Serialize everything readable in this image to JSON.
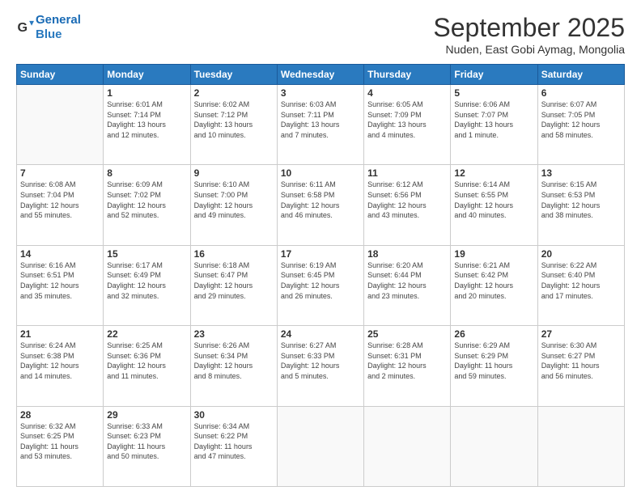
{
  "logo": {
    "line1": "General",
    "line2": "Blue"
  },
  "header": {
    "title": "September 2025",
    "subtitle": "Nuden, East Gobi Aymag, Mongolia"
  },
  "weekdays": [
    "Sunday",
    "Monday",
    "Tuesday",
    "Wednesday",
    "Thursday",
    "Friday",
    "Saturday"
  ],
  "weeks": [
    [
      {
        "day": "",
        "info": ""
      },
      {
        "day": "1",
        "info": "Sunrise: 6:01 AM\nSunset: 7:14 PM\nDaylight: 13 hours\nand 12 minutes."
      },
      {
        "day": "2",
        "info": "Sunrise: 6:02 AM\nSunset: 7:12 PM\nDaylight: 13 hours\nand 10 minutes."
      },
      {
        "day": "3",
        "info": "Sunrise: 6:03 AM\nSunset: 7:11 PM\nDaylight: 13 hours\nand 7 minutes."
      },
      {
        "day": "4",
        "info": "Sunrise: 6:05 AM\nSunset: 7:09 PM\nDaylight: 13 hours\nand 4 minutes."
      },
      {
        "day": "5",
        "info": "Sunrise: 6:06 AM\nSunset: 7:07 PM\nDaylight: 13 hours\nand 1 minute."
      },
      {
        "day": "6",
        "info": "Sunrise: 6:07 AM\nSunset: 7:05 PM\nDaylight: 12 hours\nand 58 minutes."
      }
    ],
    [
      {
        "day": "7",
        "info": "Sunrise: 6:08 AM\nSunset: 7:04 PM\nDaylight: 12 hours\nand 55 minutes."
      },
      {
        "day": "8",
        "info": "Sunrise: 6:09 AM\nSunset: 7:02 PM\nDaylight: 12 hours\nand 52 minutes."
      },
      {
        "day": "9",
        "info": "Sunrise: 6:10 AM\nSunset: 7:00 PM\nDaylight: 12 hours\nand 49 minutes."
      },
      {
        "day": "10",
        "info": "Sunrise: 6:11 AM\nSunset: 6:58 PM\nDaylight: 12 hours\nand 46 minutes."
      },
      {
        "day": "11",
        "info": "Sunrise: 6:12 AM\nSunset: 6:56 PM\nDaylight: 12 hours\nand 43 minutes."
      },
      {
        "day": "12",
        "info": "Sunrise: 6:14 AM\nSunset: 6:55 PM\nDaylight: 12 hours\nand 40 minutes."
      },
      {
        "day": "13",
        "info": "Sunrise: 6:15 AM\nSunset: 6:53 PM\nDaylight: 12 hours\nand 38 minutes."
      }
    ],
    [
      {
        "day": "14",
        "info": "Sunrise: 6:16 AM\nSunset: 6:51 PM\nDaylight: 12 hours\nand 35 minutes."
      },
      {
        "day": "15",
        "info": "Sunrise: 6:17 AM\nSunset: 6:49 PM\nDaylight: 12 hours\nand 32 minutes."
      },
      {
        "day": "16",
        "info": "Sunrise: 6:18 AM\nSunset: 6:47 PM\nDaylight: 12 hours\nand 29 minutes."
      },
      {
        "day": "17",
        "info": "Sunrise: 6:19 AM\nSunset: 6:45 PM\nDaylight: 12 hours\nand 26 minutes."
      },
      {
        "day": "18",
        "info": "Sunrise: 6:20 AM\nSunset: 6:44 PM\nDaylight: 12 hours\nand 23 minutes."
      },
      {
        "day": "19",
        "info": "Sunrise: 6:21 AM\nSunset: 6:42 PM\nDaylight: 12 hours\nand 20 minutes."
      },
      {
        "day": "20",
        "info": "Sunrise: 6:22 AM\nSunset: 6:40 PM\nDaylight: 12 hours\nand 17 minutes."
      }
    ],
    [
      {
        "day": "21",
        "info": "Sunrise: 6:24 AM\nSunset: 6:38 PM\nDaylight: 12 hours\nand 14 minutes."
      },
      {
        "day": "22",
        "info": "Sunrise: 6:25 AM\nSunset: 6:36 PM\nDaylight: 12 hours\nand 11 minutes."
      },
      {
        "day": "23",
        "info": "Sunrise: 6:26 AM\nSunset: 6:34 PM\nDaylight: 12 hours\nand 8 minutes."
      },
      {
        "day": "24",
        "info": "Sunrise: 6:27 AM\nSunset: 6:33 PM\nDaylight: 12 hours\nand 5 minutes."
      },
      {
        "day": "25",
        "info": "Sunrise: 6:28 AM\nSunset: 6:31 PM\nDaylight: 12 hours\nand 2 minutes."
      },
      {
        "day": "26",
        "info": "Sunrise: 6:29 AM\nSunset: 6:29 PM\nDaylight: 11 hours\nand 59 minutes."
      },
      {
        "day": "27",
        "info": "Sunrise: 6:30 AM\nSunset: 6:27 PM\nDaylight: 11 hours\nand 56 minutes."
      }
    ],
    [
      {
        "day": "28",
        "info": "Sunrise: 6:32 AM\nSunset: 6:25 PM\nDaylight: 11 hours\nand 53 minutes."
      },
      {
        "day": "29",
        "info": "Sunrise: 6:33 AM\nSunset: 6:23 PM\nDaylight: 11 hours\nand 50 minutes."
      },
      {
        "day": "30",
        "info": "Sunrise: 6:34 AM\nSunset: 6:22 PM\nDaylight: 11 hours\nand 47 minutes."
      },
      {
        "day": "",
        "info": ""
      },
      {
        "day": "",
        "info": ""
      },
      {
        "day": "",
        "info": ""
      },
      {
        "day": "",
        "info": ""
      }
    ]
  ]
}
